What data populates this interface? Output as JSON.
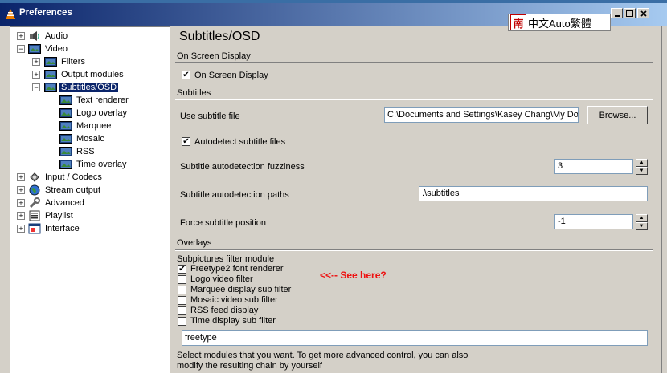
{
  "window": {
    "title": "Preferences",
    "ime_text": "中文Auto繁體",
    "ime_logo": "南"
  },
  "tree": {
    "items": [
      {
        "label": "Audio",
        "icon": "speaker-icon"
      },
      {
        "label": "Video",
        "icon": "video-icon"
      },
      {
        "label": "Filters",
        "icon": "video-icon"
      },
      {
        "label": "Output modules",
        "icon": "video-icon"
      },
      {
        "label": "Subtitles/OSD",
        "icon": "video-icon"
      },
      {
        "label": "Text renderer",
        "icon": "video-icon"
      },
      {
        "label": "Logo overlay",
        "icon": "video-icon"
      },
      {
        "label": "Marquee",
        "icon": "video-icon"
      },
      {
        "label": "Mosaic",
        "icon": "video-icon"
      },
      {
        "label": "RSS",
        "icon": "video-icon"
      },
      {
        "label": "Time overlay",
        "icon": "video-icon"
      },
      {
        "label": "Input / Codecs",
        "icon": "codecs-icon"
      },
      {
        "label": "Stream output",
        "icon": "globe-icon"
      },
      {
        "label": "Advanced",
        "icon": "wrench-icon"
      },
      {
        "label": "Playlist",
        "icon": "playlist-icon"
      },
      {
        "label": "Interface",
        "icon": "interface-icon"
      }
    ]
  },
  "panel": {
    "title": "Subtitles/OSD",
    "osd_section": "On Screen Display",
    "osd_checkbox": "On Screen Display",
    "subtitles_section": "Subtitles",
    "use_subtitle_file_label": "Use subtitle file",
    "subtitle_file_value": "C:\\Documents and Settings\\Kasey Chang\\My Doc",
    "browse_label": "Browse...",
    "autodetect_label": "Autodetect subtitle files",
    "fuzziness_label": "Subtitle autodetection fuzziness",
    "fuzziness_value": "3",
    "paths_label": "Subtitle autodetection paths",
    "paths_value": ".\\subtitles",
    "force_position_label": "Force subtitle position",
    "force_position_value": "-1",
    "overlays_section": "Overlays",
    "subpictures_label": "Subpictures filter module",
    "filters": [
      {
        "label": "Freetype2 font renderer",
        "checked": true
      },
      {
        "label": "Logo video filter",
        "checked": false
      },
      {
        "label": "Marquee display sub filter",
        "checked": false
      },
      {
        "label": "Mosaic video sub filter",
        "checked": false
      },
      {
        "label": "RSS feed display",
        "checked": false
      },
      {
        "label": "Time display sub filter",
        "checked": false
      }
    ],
    "annotation": "<<-- See here?",
    "chain_value": "freetype",
    "help_line1": "Select modules that you want. To get more advanced control, you can also",
    "help_line2": "modify the resulting chain by yourself"
  },
  "colors": {
    "selection": "#0a246a",
    "annotation": "#e11111"
  }
}
